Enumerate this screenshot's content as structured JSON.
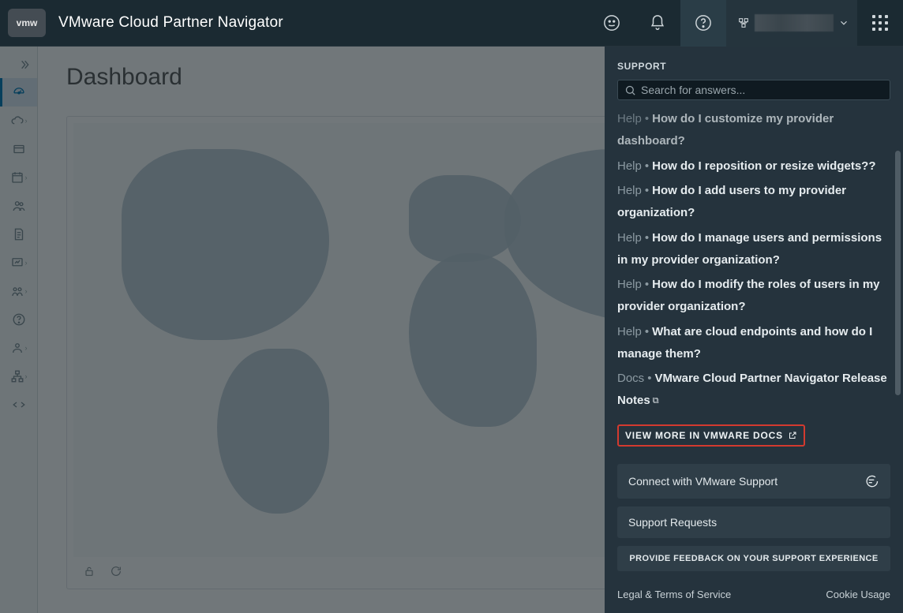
{
  "header": {
    "logo_text": "vmw",
    "title": "VMware Cloud Partner Navigator"
  },
  "page": {
    "title": "Dashboard"
  },
  "sidebar": {
    "items": [
      {
        "name": "dashboard"
      },
      {
        "name": "cloud-services"
      },
      {
        "name": "customers"
      },
      {
        "name": "schedule"
      },
      {
        "name": "users"
      },
      {
        "name": "billing"
      },
      {
        "name": "reports"
      },
      {
        "name": "partners"
      },
      {
        "name": "support"
      },
      {
        "name": "admin"
      },
      {
        "name": "org-tree"
      },
      {
        "name": "dev"
      }
    ]
  },
  "support": {
    "header": "SUPPORT",
    "search_placeholder": "Search for answers...",
    "items": [
      {
        "badge": "Help",
        "title": "How do I customize my provider dashboard?",
        "faded": true
      },
      {
        "badge": "Help",
        "title": "How do I reposition or resize widgets??"
      },
      {
        "badge": "Help",
        "title": "How do I add users to my provider organization?"
      },
      {
        "badge": "Help",
        "title": "How do I manage users and permissions in my provider organization?"
      },
      {
        "badge": "Help",
        "title": "How do I modify the roles of users in my provider organization?"
      },
      {
        "badge": "Help",
        "title": "What are cloud endpoints and how do I manage them?"
      },
      {
        "badge": "Docs",
        "title": "VMware Cloud Partner Navigator Release Notes",
        "external": true
      }
    ],
    "view_more": "VIEW MORE IN VMWARE DOCS",
    "connect": "Connect with VMware Support",
    "requests": "Support Requests",
    "feedback": "PROVIDE FEEDBACK ON YOUR SUPPORT EXPERIENCE",
    "legal": "Legal & Terms of Service",
    "cookie": "Cookie Usage"
  }
}
